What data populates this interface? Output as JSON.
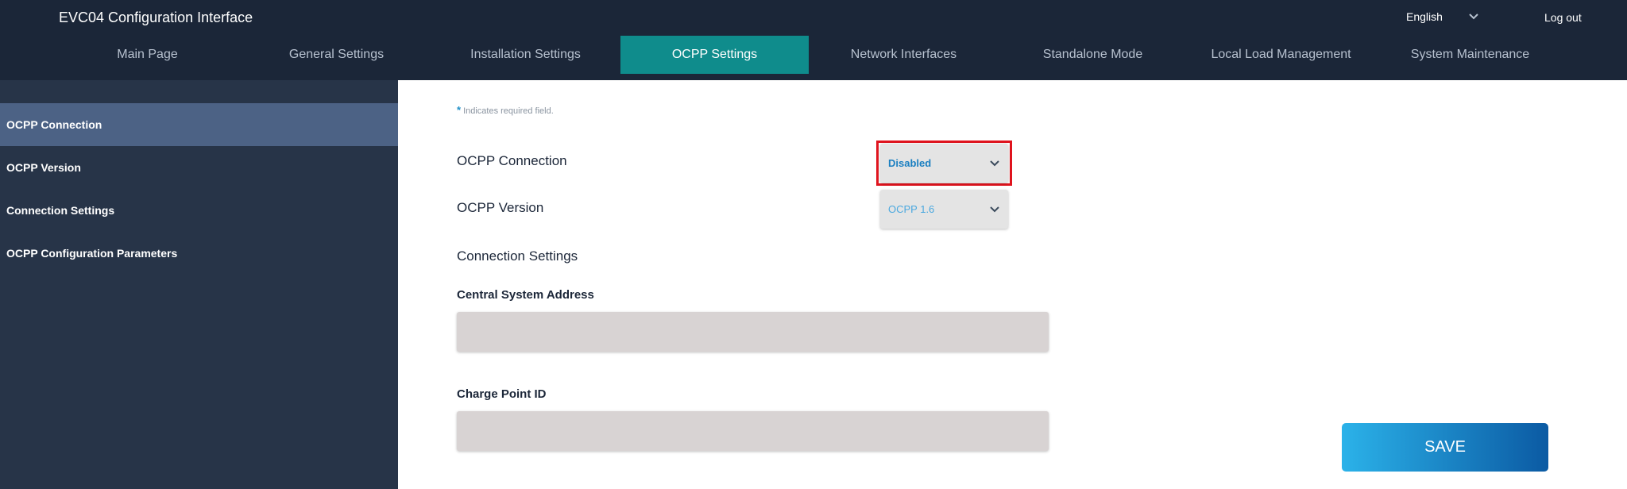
{
  "header": {
    "title": "EVC04 Configuration Interface",
    "language": "English",
    "logout": "Log out"
  },
  "nav": {
    "items": [
      {
        "label": "Main Page"
      },
      {
        "label": "General Settings"
      },
      {
        "label": "Installation Settings"
      },
      {
        "label": "OCPP Settings"
      },
      {
        "label": "Network Interfaces"
      },
      {
        "label": "Standalone Mode"
      },
      {
        "label": "Local Load Management"
      },
      {
        "label": "System Maintenance"
      }
    ],
    "active": "OCPP Settings"
  },
  "sidebar": {
    "items": [
      {
        "label": "OCPP Connection"
      },
      {
        "label": "OCPP Version"
      },
      {
        "label": "Connection Settings"
      },
      {
        "label": "OCPP Configuration Parameters"
      }
    ],
    "active": "OCPP Connection"
  },
  "form": {
    "required_star": "*",
    "required_note": "Indicates required field.",
    "ocpp_connection_label": "OCPP Connection",
    "ocpp_connection_value": "Disabled",
    "ocpp_version_label": "OCPP Version",
    "ocpp_version_value": "OCPP 1.6",
    "connection_settings_label": "Connection Settings",
    "central_system_address_label": "Central System Address",
    "central_system_address_value": "",
    "charge_point_id_label": "Charge Point ID",
    "charge_point_id_value": "",
    "save_label": "SAVE"
  },
  "colors": {
    "header_bg": "#1b2638",
    "nav_active_bg": "#0f8c8c",
    "sidebar_bg": "#273448",
    "sidebar_active_bg": "#4c6285",
    "select_value_blue": "#1a7fc1",
    "highlight_red": "#e0141e",
    "save_gradient_start": "#2bb2e9",
    "save_gradient_end": "#0b5aa3"
  },
  "icons": {
    "dropdown": "chevron-down-icon"
  }
}
